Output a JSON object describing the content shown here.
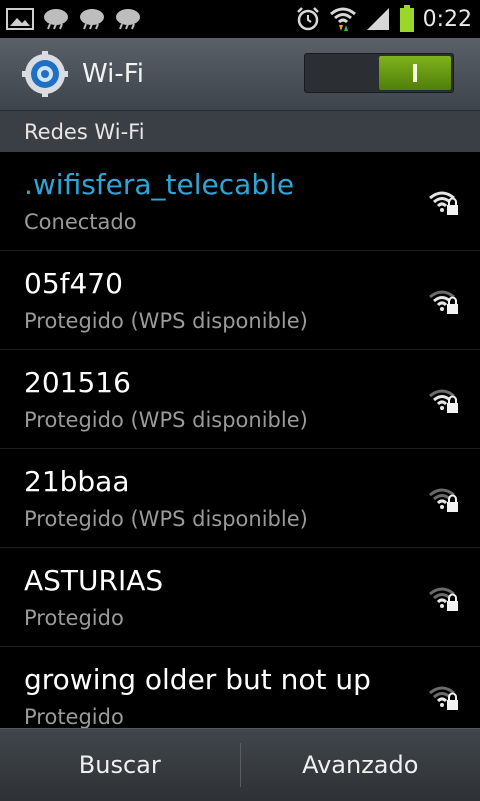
{
  "status_bar": {
    "time": "0:22",
    "left_icons": [
      "image-notification-icon",
      "weather-icon",
      "weather-icon",
      "weather-icon"
    ],
    "right_icons": [
      "alarm-clock-icon",
      "wifi-data-icon",
      "signal-icon",
      "battery-icon"
    ]
  },
  "action_bar": {
    "title": "Wi-Fi",
    "icon": "wifi-settings-icon",
    "toggle_on": true
  },
  "section": {
    "label": "Redes Wi-Fi"
  },
  "networks": [
    {
      "name": ".wifisfera_telecable",
      "status": "Conectado",
      "connected": true
    },
    {
      "name": "05f470",
      "status": "Protegido (WPS disponible)",
      "connected": false
    },
    {
      "name": "201516",
      "status": "Protegido (WPS disponible)",
      "connected": false
    },
    {
      "name": "21bbaa",
      "status": "Protegido (WPS disponible)",
      "connected": false
    },
    {
      "name": "ASTURIAS",
      "status": "Protegido",
      "connected": false
    },
    {
      "name": "growing older but not up",
      "status": "Protegido",
      "connected": false
    }
  ],
  "bottom_bar": {
    "scan_label": "Buscar",
    "advanced_label": "Avanzado"
  },
  "colors": {
    "accent": "#2fa4d6",
    "toggle_on": "#6a9e12"
  }
}
